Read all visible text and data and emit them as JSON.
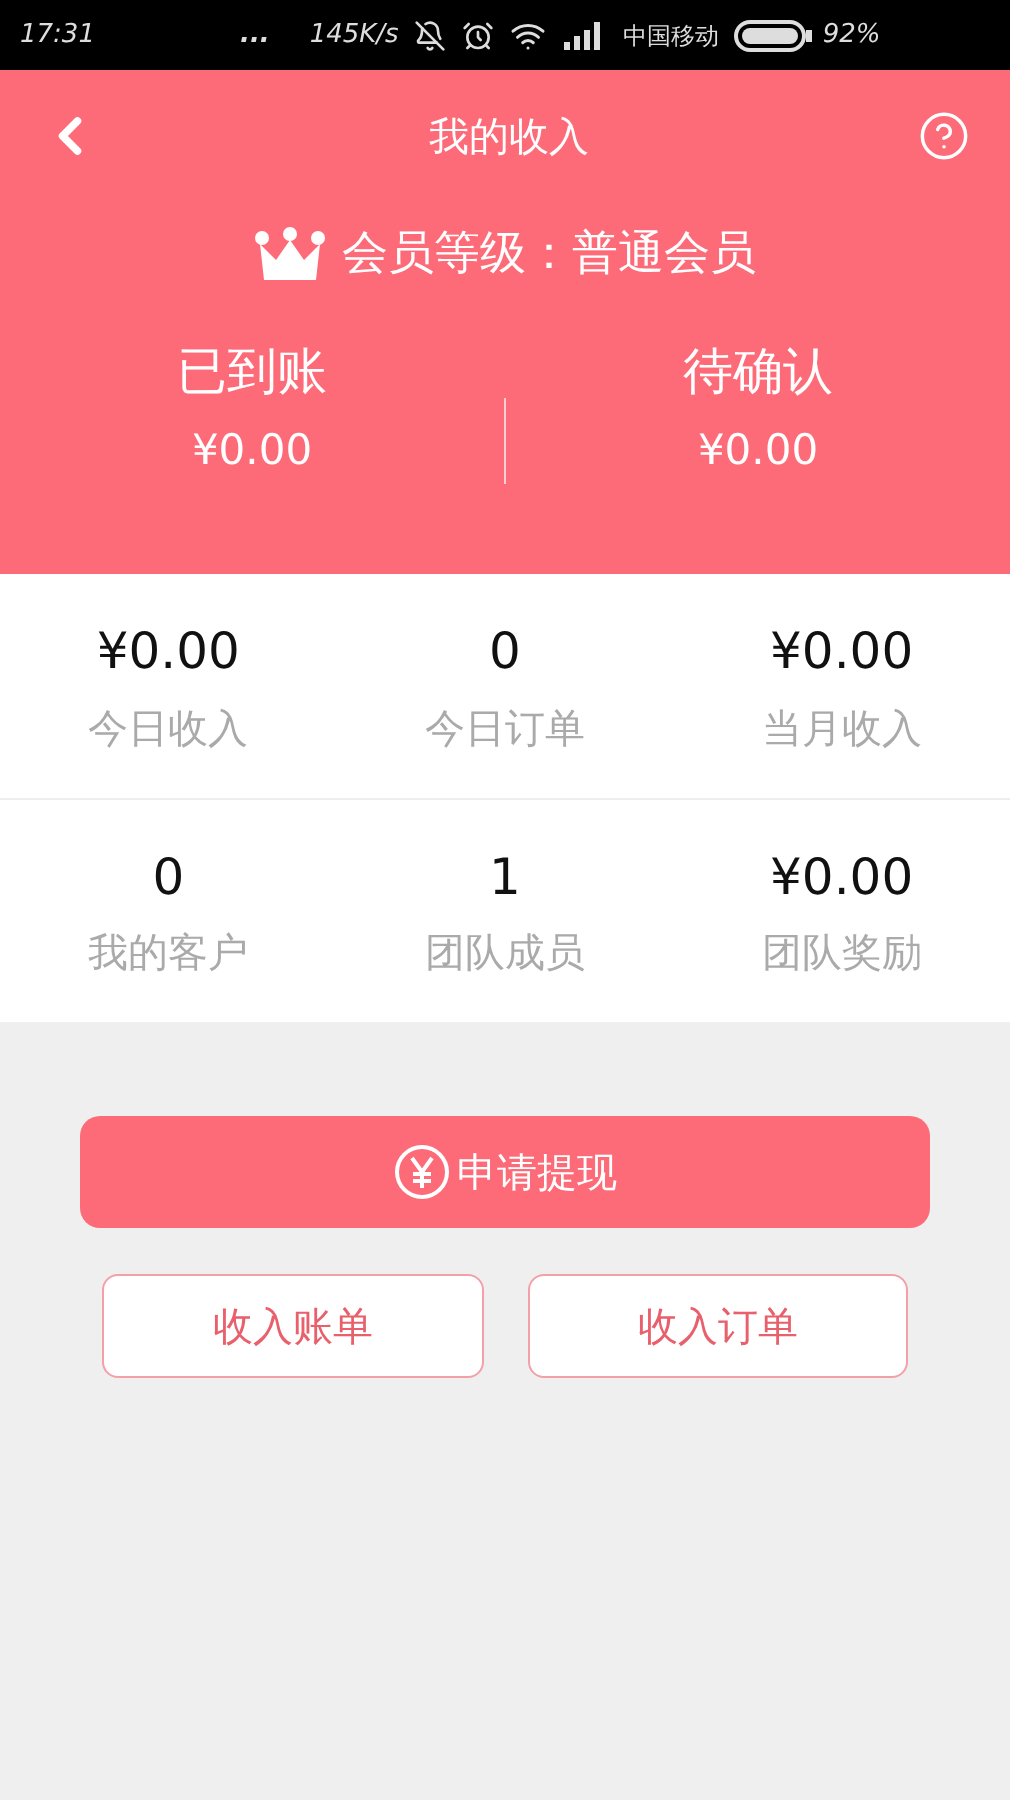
{
  "status_bar": {
    "time": "17:31",
    "dots": "...",
    "speed": "145K/s",
    "carrier": "中国移动",
    "battery": "92%"
  },
  "header": {
    "title": "我的收入",
    "member_level": "会员等级：普通会员"
  },
  "balances": [
    {
      "label": "已到账",
      "amount": "¥0.00"
    },
    {
      "label": "待确认",
      "amount": "¥0.00"
    }
  ],
  "stats": [
    {
      "value": "¥0.00",
      "label": "今日收入"
    },
    {
      "value": "0",
      "label": "今日订单"
    },
    {
      "value": "¥0.00",
      "label": "当月收入"
    },
    {
      "value": "0",
      "label": "我的客户"
    },
    {
      "value": "1",
      "label": "团队成员"
    },
    {
      "value": "¥0.00",
      "label": "团队奖励"
    }
  ],
  "withdraw_button": "申请提现",
  "buttons": [
    "收入账单",
    "收入订单"
  ]
}
